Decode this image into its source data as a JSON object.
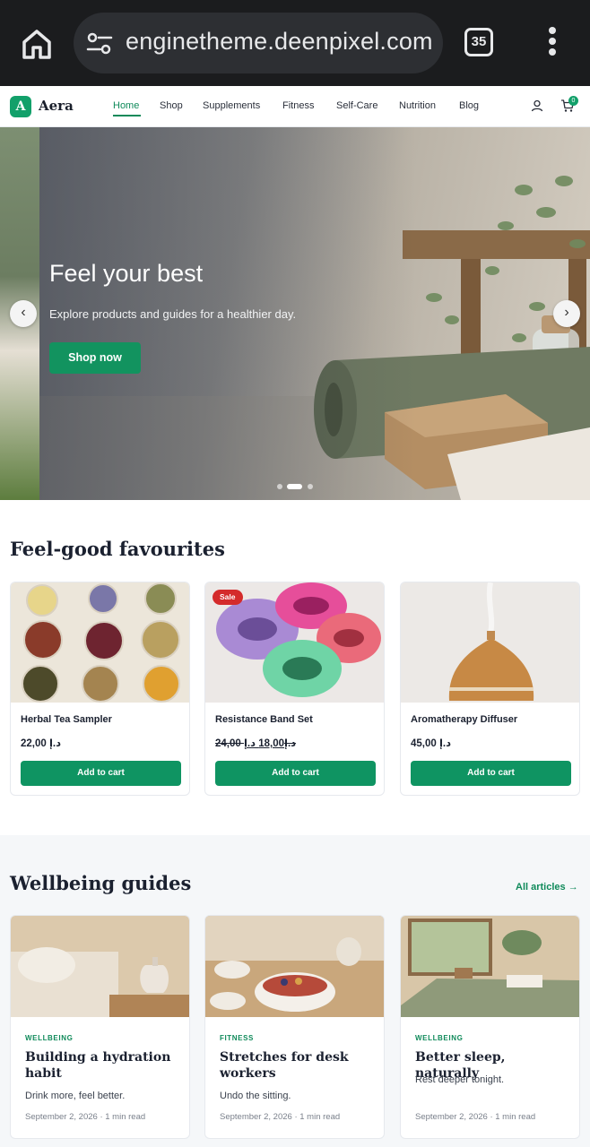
{
  "browser": {
    "url": "enginetheme.deenpixel.com",
    "tab_count": "35"
  },
  "site": {
    "logo_letter": "A",
    "logo_name": "Aera",
    "nav": [
      "Home",
      "Shop",
      "Supplements",
      "Fitness",
      "Self-Care",
      "Nutrition",
      "Blog"
    ],
    "active_nav": "Home",
    "cart_count": "0",
    "accent_color": "#12935f"
  },
  "hero": {
    "title": "Feel your best",
    "subtitle": "Explore products and guides for a healthier day.",
    "cta": "Shop now",
    "prev_arrow": "‹",
    "next_arrow": "›",
    "slide_count": 3,
    "active_slide": 2
  },
  "favourites": {
    "title": "Feel-good favourites",
    "products": [
      {
        "name": "Herbal Tea Sampler",
        "price": "22,00 د.إ",
        "old_price": "",
        "sale": "",
        "button": "Add to cart"
      },
      {
        "name": "Resistance Band Set",
        "price": "18,00 د.إ",
        "old_price": "24,00 د.إ",
        "sale": "Sale",
        "button": "Add to cart"
      },
      {
        "name": "Aromatherapy Diffuser",
        "price": "45,00 د.إ",
        "old_price": "",
        "sale": "",
        "button": "Add to cart"
      }
    ]
  },
  "guides": {
    "title": "Wellbeing guides",
    "all_link": "All articles →",
    "articles": [
      {
        "category": "WELLBEING",
        "title": "Building a hydration habit",
        "excerpt": "Drink more, feel better.",
        "meta": "September 2, 2026 · 1 min read"
      },
      {
        "category": "FITNESS",
        "title": "Stretches for desk workers",
        "excerpt": "Undo the sitting.",
        "meta": "September 2, 2026 · 1 min read"
      },
      {
        "category": "WELLBEING",
        "title": "Better sleep, naturally",
        "excerpt": "Rest deeper tonight.",
        "meta": "September 2, 2026 · 1 min read"
      }
    ]
  }
}
